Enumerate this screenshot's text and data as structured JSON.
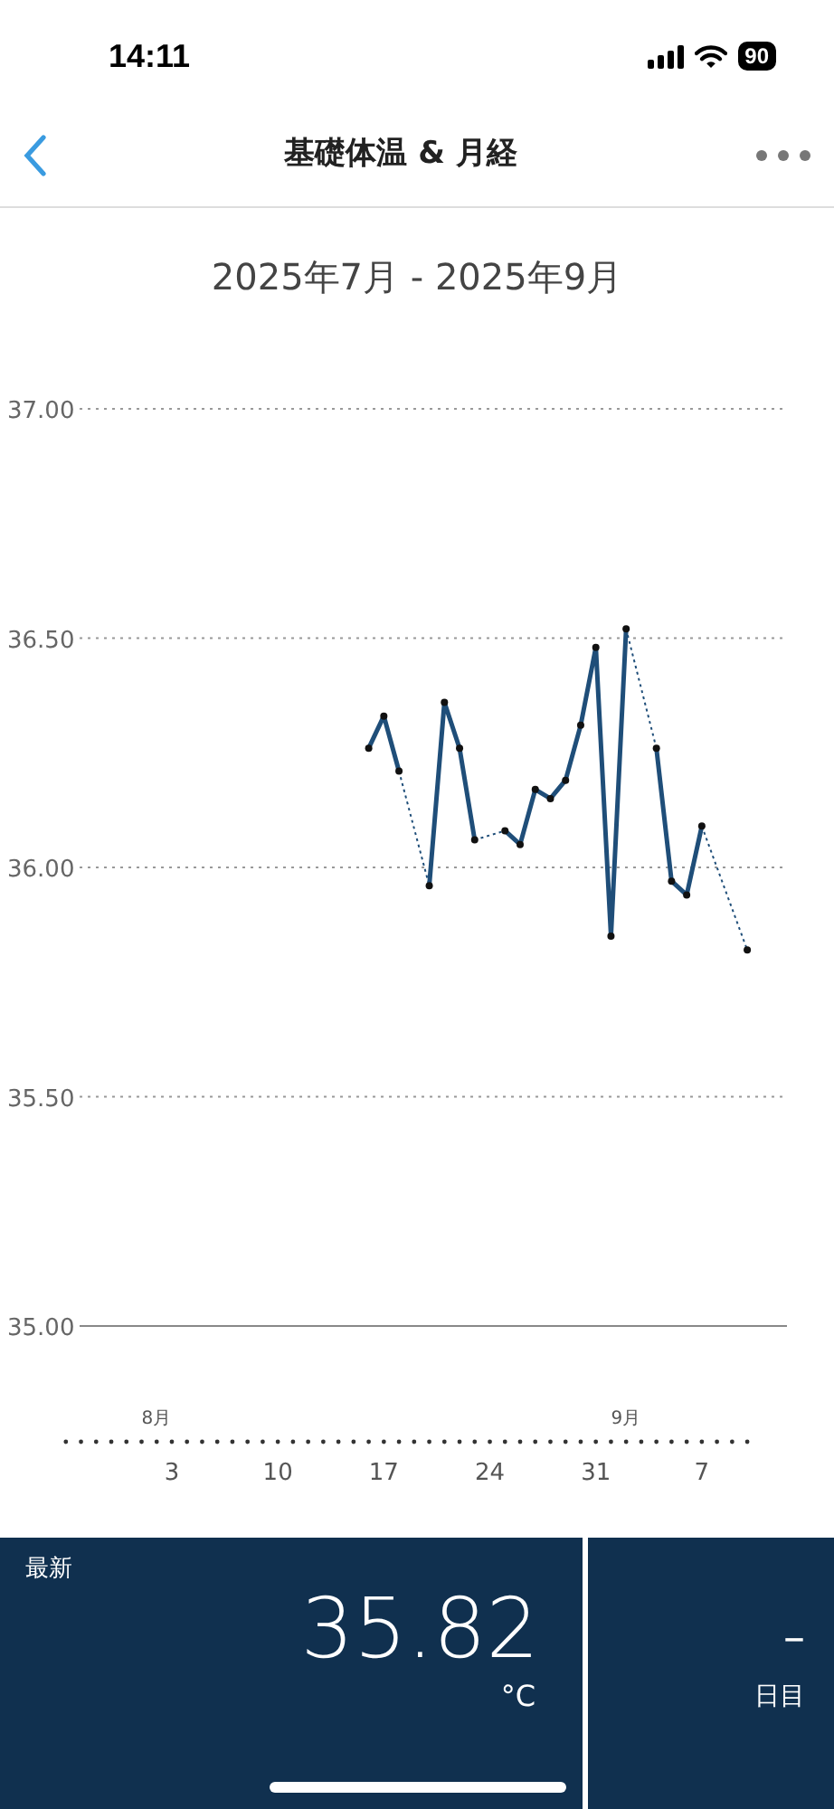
{
  "status_bar": {
    "time": "14:11",
    "battery": "90"
  },
  "nav": {
    "title": "基礎体温 & 月経"
  },
  "date_range": "2025年7月 - 2025年9月",
  "chart": {
    "chart_data": {
      "type": "line",
      "categories": [
        null,
        null,
        null,
        null,
        null,
        null,
        null,
        "3",
        null,
        null,
        null,
        null,
        null,
        null,
        "10",
        null,
        null,
        null,
        null,
        null,
        null,
        "17",
        null,
        null,
        null,
        null,
        null,
        null,
        "24",
        null,
        null,
        null,
        null,
        null,
        null,
        "31",
        null,
        null,
        null,
        null,
        null,
        null,
        "7",
        null,
        null,
        null
      ],
      "series": [
        {
          "color": "#1f4e79",
          "marker": true,
          "values": [
            null,
            null,
            null,
            null,
            null,
            null,
            null,
            null,
            null,
            null,
            null,
            null,
            null,
            null,
            null,
            null,
            null,
            null,
            null,
            null,
            36.26,
            36.33,
            36.21,
            null,
            35.96,
            36.36,
            36.26,
            36.06,
            null,
            36.08,
            36.05,
            36.17,
            36.15,
            36.19,
            36.31,
            36.48,
            35.85,
            36.52,
            null,
            36.26,
            35.97,
            35.94,
            36.09,
            null,
            null,
            35.82
          ]
        }
      ],
      "ylim": [
        35,
        37
      ],
      "grid": true,
      "yticks": [
        {
          "value": 35,
          "label": "35.00"
        },
        {
          "value": 35.5,
          "label": "35.50"
        },
        {
          "value": 36,
          "label": "36.00"
        },
        {
          "value": 36.5,
          "label": "36.50"
        },
        {
          "value": 37,
          "label": "37.00"
        }
      ]
    },
    "month_labels": [
      "8月",
      "9月"
    ]
  },
  "summary": {
    "latest": {
      "label": "最新",
      "value": "35.82",
      "unit": "°C"
    },
    "cycle": {
      "value": "–",
      "unit": "日目"
    }
  }
}
